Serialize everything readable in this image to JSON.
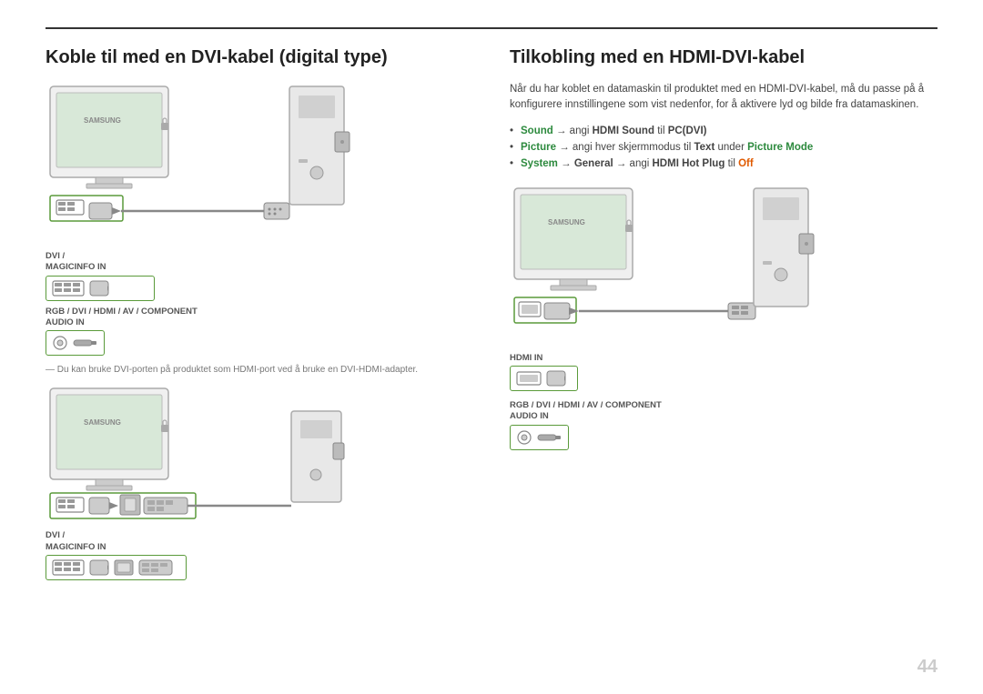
{
  "page": {
    "number": "44"
  },
  "left": {
    "title": "Koble til med en DVI-kabel (digital type)",
    "footnote": "Du kan bruke DVI-porten på produktet som HDMI-port ved å bruke en DVI-HDMI-adapter.",
    "port_labels": {
      "dvi": "DVI /\nMAGICINFO IN",
      "audio": "RGB / DVI / HDMI / AV / COMPONENT\nAUDIO IN",
      "dvi2": "DVI /\nMAGICINFO IN"
    }
  },
  "right": {
    "title": "Tilkobling med en HDMI-DVI-kabel",
    "description": "Når du har koblet en datamaskin til produktet med en HDMI-DVI-kabel, må du passe på å konfigurere innstillingene som vist nedenfor, for å aktivere lyd og bilde fra datamaskinen.",
    "bullets": [
      {
        "prefix": "",
        "green_text": "Sound",
        "middle": " → angi ",
        "bold1": "HDMI Sound",
        "after1": " til ",
        "green_text2": "PC(DVI)",
        "rest": ""
      },
      {
        "prefix": "",
        "green_text": "Picture",
        "middle": " → angi hver skjermmodus til ",
        "bold1": "Text",
        "after1": " under ",
        "green_text2": "Picture Mode",
        "rest": ""
      },
      {
        "prefix": "",
        "green_text": "System",
        "middle": " → ",
        "bold1": "General",
        "after1": " → angi ",
        "green_text2": "HDMI Hot Plug",
        "after2": " til ",
        "bold2": "Off",
        "rest": ""
      }
    ],
    "port_labels": {
      "hdmi": "HDMI IN",
      "audio": "RGB / DVI / HDMI / AV / COMPONENT\nAUDIO IN"
    }
  }
}
